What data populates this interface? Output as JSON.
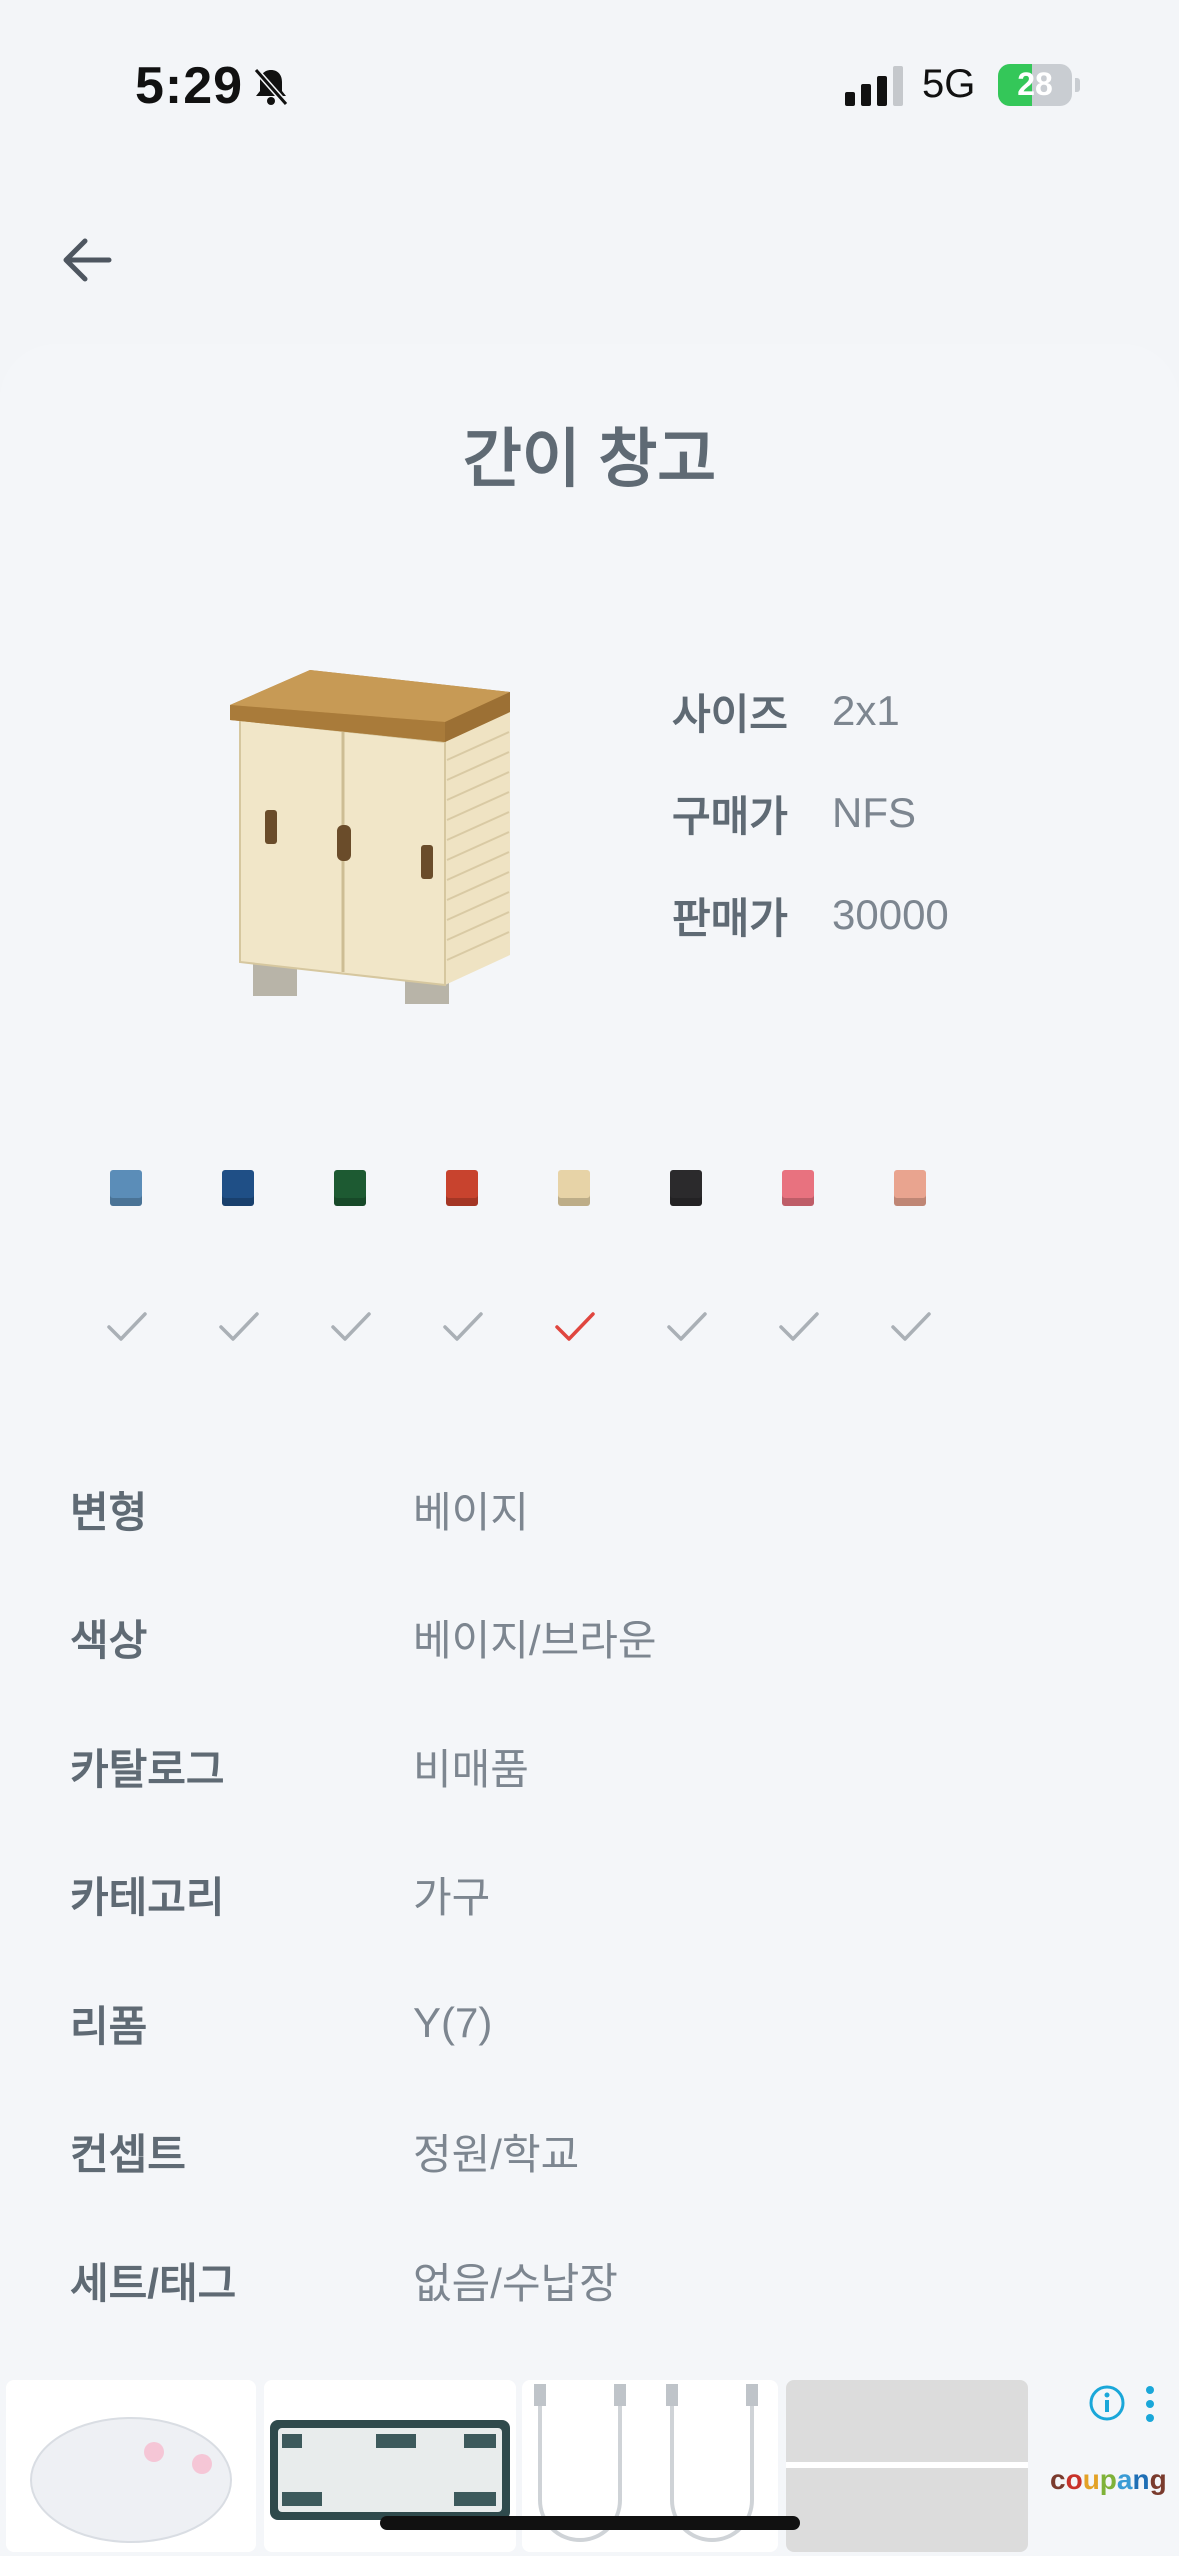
{
  "status": {
    "time": "5:29",
    "network": "5G",
    "battery": "28"
  },
  "header": {
    "back_icon": "arrow-left-icon"
  },
  "item": {
    "title": "간이 창고",
    "specs": [
      {
        "label": "사이즈",
        "value": "2x1"
      },
      {
        "label": "구매가",
        "value": "NFS"
      },
      {
        "label": "판매가",
        "value": "30000"
      }
    ]
  },
  "variants": [
    {
      "color": "#5b8db8",
      "checked": false
    },
    {
      "color": "#1f4f86",
      "checked": false
    },
    {
      "color": "#1d5a32",
      "checked": false
    },
    {
      "color": "#c8432e",
      "checked": false
    },
    {
      "color": "#e7d3a7",
      "checked": true
    },
    {
      "color": "#2b2a2c",
      "checked": false
    },
    {
      "color": "#e8727f",
      "checked": false
    },
    {
      "color": "#e9a48f",
      "checked": false
    }
  ],
  "details": [
    {
      "label": "변형",
      "value": "베이지"
    },
    {
      "label": "색상",
      "value": "베이지/브라운"
    },
    {
      "label": "카탈로그",
      "value": "비매품"
    },
    {
      "label": "카테고리",
      "value": "가구"
    },
    {
      "label": "리폼",
      "value": "Y(7)"
    },
    {
      "label": "컨셉트",
      "value": "정원/학교"
    },
    {
      "label": "세트/태그",
      "value": "없음/수납장"
    }
  ],
  "ad": {
    "logo": "coupang",
    "info_icon": "info-icon",
    "menu_icon": "more-vertical-icon"
  },
  "colors": {
    "accent_check": "#e0463f",
    "muted_check": "#aab0b6",
    "text_label": "#5f6a74",
    "text_value": "#7d8690"
  }
}
